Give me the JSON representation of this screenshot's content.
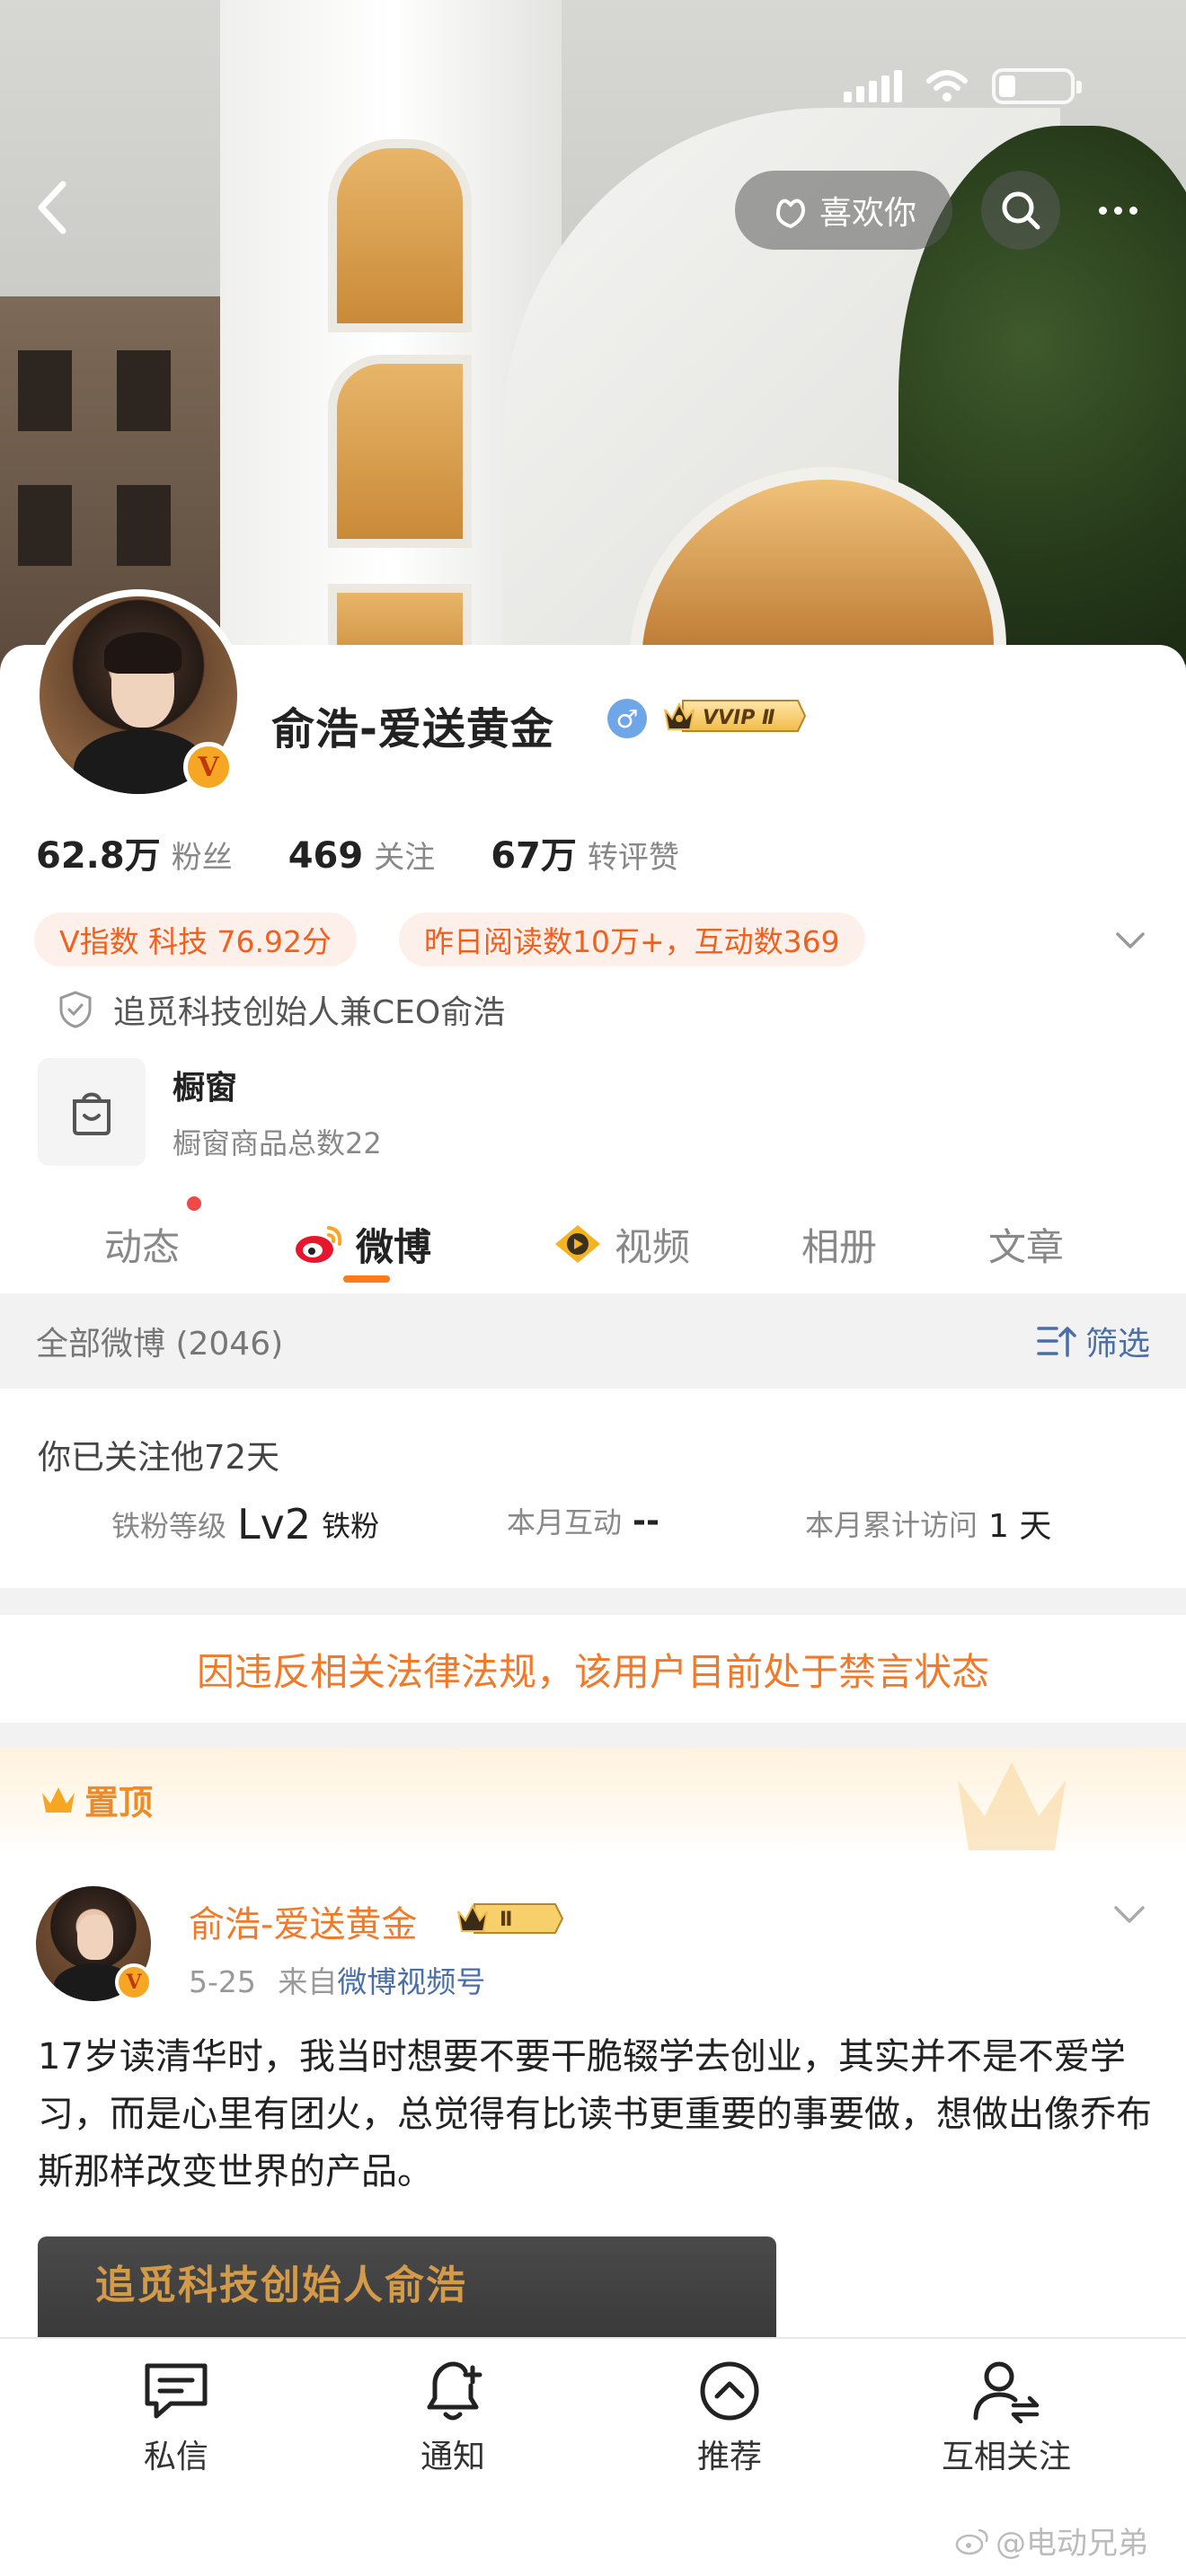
{
  "nav": {
    "like_label": "喜欢你"
  },
  "profile": {
    "name": "俞浩-爱送黄金",
    "gender_symbol": "♂",
    "vip_label": "VVIP Ⅱ",
    "v_badge": "V",
    "stats": [
      {
        "value": "62.8万",
        "label": "粉丝"
      },
      {
        "value": "469",
        "label": "关注"
      },
      {
        "value": "67万",
        "label": "转评赞"
      }
    ],
    "chips": [
      "V指数 科技 76.92分",
      "昨日阅读数10万+，互动数369"
    ],
    "certification": "追觅科技创始人兼CEO俞浩",
    "shop": {
      "title": "橱窗",
      "subtitle": "橱窗商品总数22"
    }
  },
  "tabs": [
    {
      "label": "动态",
      "active": false
    },
    {
      "label": "微博",
      "active": true
    },
    {
      "label": "视频",
      "active": false
    },
    {
      "label": "相册",
      "active": false
    },
    {
      "label": "文章",
      "active": false
    }
  ],
  "filter_bar": {
    "all_label": "全部微博 (2046)",
    "filter_label": "筛选"
  },
  "follow_panel": {
    "days_text": "你已关注他72天",
    "iron_fan_label": "铁粉等级",
    "iron_fan_level": "Lv2",
    "iron_fan_suffix": "铁粉",
    "monthly_interact_label": "本月互动",
    "monthly_interact_value": "--",
    "monthly_visit_label": "本月累计访问",
    "monthly_visit_value": "1 天"
  },
  "ban_notice": "因违反相关法律法规，该用户目前处于禁言状态",
  "pinned_label": "置顶",
  "post": {
    "author": "俞浩-爱送黄金",
    "vip_label": "Ⅱ",
    "date": "5-25",
    "from_prefix": "来自",
    "source": "微博视频号",
    "text": "17岁读清华时，我当时想要不要干脆辍学去创业，其实并不是不爱学习，而是心里有团火，总觉得有比读书更重要的事要做，想做出像乔布斯那样改变世界的产品。",
    "image_caption": "追觅科技创始人俞浩"
  },
  "bottom_bar": [
    {
      "label": "私信",
      "icon": "message-icon"
    },
    {
      "label": "通知",
      "icon": "bell-add-icon"
    },
    {
      "label": "推荐",
      "icon": "recommend-icon"
    },
    {
      "label": "互相关注",
      "icon": "mutual-follow-icon"
    }
  ],
  "watermark": "@电动兄弟",
  "colors": {
    "accent_orange": "#f07a2a",
    "link_blue": "#4a6ea8",
    "chip_bg": "#fdf0ea"
  }
}
